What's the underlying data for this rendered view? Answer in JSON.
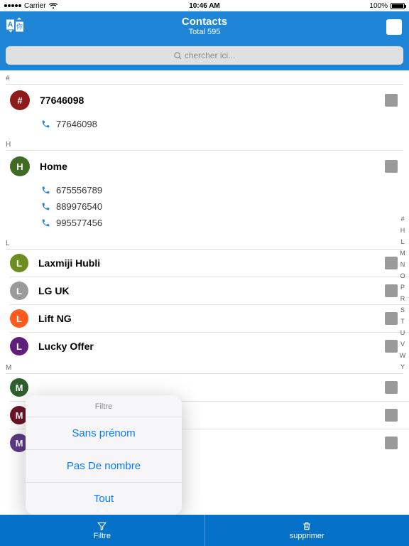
{
  "status": {
    "carrier": "Carrier",
    "time": "10:46 AM",
    "battery": "100%"
  },
  "header": {
    "title": "Contacts",
    "subtitle": "Total 595"
  },
  "search": {
    "placeholder": "chercher ici..."
  },
  "sections": {
    "hash": {
      "letter": "#"
    },
    "h": {
      "letter": "H"
    },
    "l": {
      "letter": "L"
    },
    "m": {
      "letter": "M"
    }
  },
  "contacts": {
    "c_hash": {
      "initial": "#",
      "name": "77646098",
      "phones": [
        "77646098"
      ],
      "color": "#8f1a1a"
    },
    "c_home": {
      "initial": "H",
      "name": "Home",
      "phones": [
        "675556789",
        "889976540",
        "995577456"
      ],
      "color": "#3f6b24"
    },
    "c_lax": {
      "initial": "L",
      "name": "Laxmiji Hubli",
      "color": "#6c8e1f"
    },
    "c_lguk": {
      "initial": "L",
      "name": "LG UK",
      "color": "#9a9a9a"
    },
    "c_lift": {
      "initial": "L",
      "name": "Lift NG",
      "color": "#ff5a1f"
    },
    "c_lucky": {
      "initial": "L",
      "name": "Lucky Offer",
      "color": "#5d1f7a"
    },
    "c_m1": {
      "initial": "M",
      "name": "",
      "color": "#2e5f2e"
    },
    "c_m2": {
      "initial": "M",
      "name": "",
      "color": "#6b1427"
    },
    "c_m3": {
      "initial": "M",
      "name": "",
      "color": "#5e3a87"
    }
  },
  "index": [
    "#",
    "H",
    "L",
    "M",
    "N",
    "O",
    "P",
    "R",
    "S",
    "T",
    "U",
    "V",
    "W",
    "Y"
  ],
  "popover": {
    "title": "Filtre",
    "opt1": "Sans prénom",
    "opt2": "Pas De nombre",
    "opt3": "Tout"
  },
  "bottom": {
    "filter": "Filtre",
    "delete": "supprimer"
  }
}
